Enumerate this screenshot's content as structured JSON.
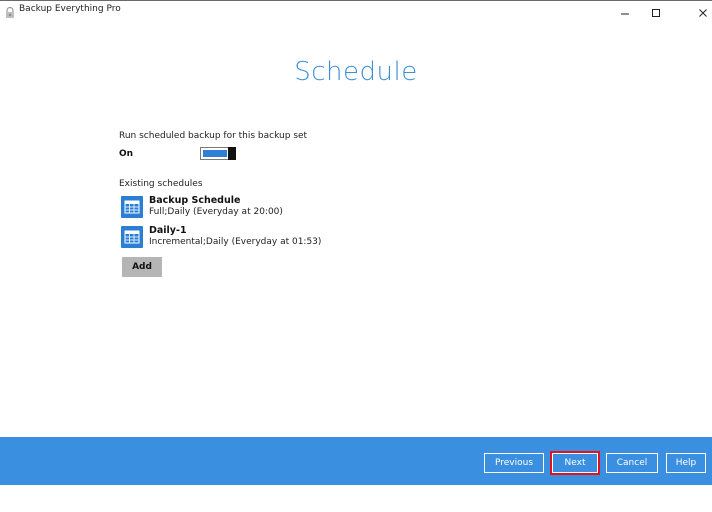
{
  "window": {
    "title": "Backup Everything Pro",
    "icon": "app-lock-icon",
    "controls": {
      "minimize": "−",
      "maximize": "☐",
      "close": "✕"
    }
  },
  "page": {
    "title": "Schedule"
  },
  "scheduled_backup": {
    "label": "Run scheduled backup for this backup set",
    "state_label": "On",
    "enabled": true
  },
  "existing_schedules": {
    "label": "Existing schedules",
    "items": [
      {
        "name": "Backup Schedule",
        "detail": "Full;Daily (Everyday at 20:00)",
        "icon": "calendar-icon"
      },
      {
        "name": "Daily-1",
        "detail": "Incremental;Daily (Everyday at 01:53)",
        "icon": "calendar-icon"
      }
    ],
    "add_label": "Add"
  },
  "footer": {
    "previous_label": "Previous",
    "next_label": "Next",
    "cancel_label": "Cancel",
    "help_label": "Help",
    "highlighted_button": "Next"
  },
  "colors": {
    "accent": "#3a8fe0",
    "title": "#3d8fd9",
    "highlight": "#e0141e",
    "icon": "#2a7fd4"
  }
}
